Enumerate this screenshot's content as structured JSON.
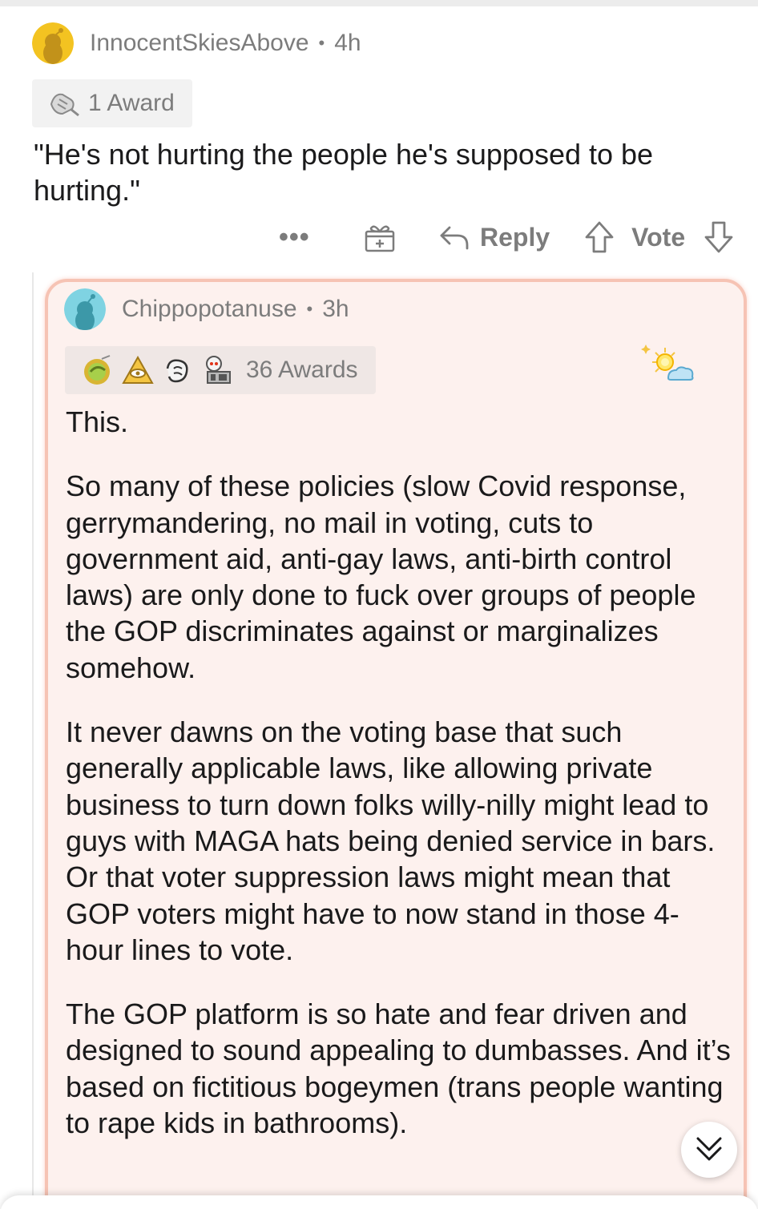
{
  "parent_comment": {
    "username": "InnocentSkiesAbove",
    "separator": "•",
    "time": "4h",
    "award_label": "1 Award",
    "body": "\"He's not hurting the people he's supposed to be hurting.\"",
    "actions": {
      "more_label": "•••",
      "reply_label": "Reply",
      "vote_label": "Vote"
    },
    "avatar_color": "#e8b81a"
  },
  "reply_comment": {
    "username": "Chippopotanuse",
    "separator": "•",
    "time": "3h",
    "award_label": "36 Awards",
    "award_icons": [
      "helpful-award-icon",
      "illuminati-award-icon",
      "facepalm-award-icon",
      "robot-award-icon"
    ],
    "avatar_color": "#58c3d6",
    "highlight_border": "#f6c3b4",
    "highlight_background": "#fdf1ee",
    "paragraphs": [
      "This.",
      "So many of these policies (slow Covid response, gerrymandering, no mail in voting, cuts to government aid, anti-gay laws, anti-birth control laws) are only done to fuck over groups of people the GOP discriminates against or marginalizes somehow.",
      "It never dawns on the voting base that such generally applicable laws, like allowing private business to turn down folks willy-nilly might lead to guys with MAGA hats being denied service in bars. Or that voter suppression laws might mean that GOP voters might have to now stand in those 4-hour lines to vote.",
      "The GOP platform is so hate and fear driven and designed to sound appealing to dumbasses. And it’s based on fictitious bogeymen (trans people wanting to rape kids in bathrooms)."
    ]
  }
}
